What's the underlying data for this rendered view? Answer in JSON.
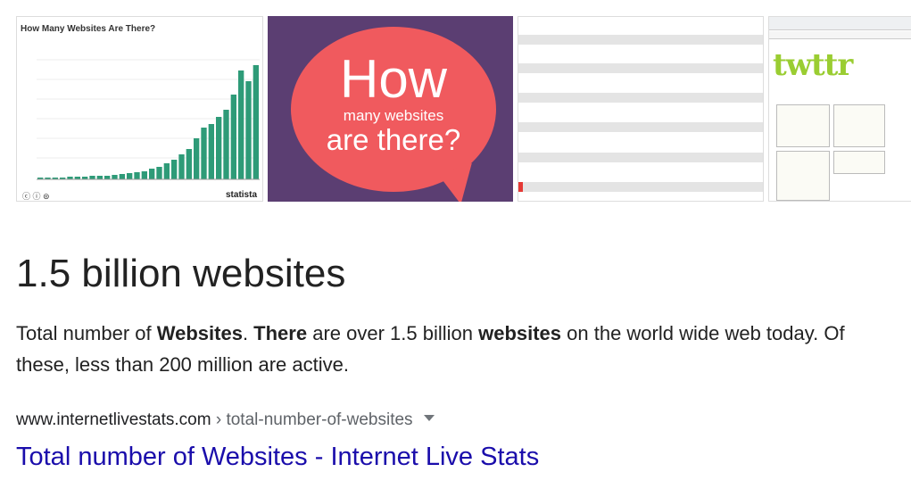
{
  "thumbnails": {
    "chart": {
      "title": "How Many Websites Are There?",
      "brand": "statista"
    },
    "bubble": {
      "line1": "How",
      "line2": "many websites",
      "line3": "are there?"
    },
    "twitter": {
      "logo": "twttr"
    }
  },
  "answer": {
    "headline": "1.5 billion websites",
    "snippet_parts": [
      {
        "text": "Total number of ",
        "bold": false
      },
      {
        "text": "Websites",
        "bold": true
      },
      {
        "text": ". ",
        "bold": false
      },
      {
        "text": "There",
        "bold": true
      },
      {
        "text": " are over 1.5 billion ",
        "bold": false
      },
      {
        "text": "websites",
        "bold": true
      },
      {
        "text": " on the world wide web today. Of these, less than 200 million are active.",
        "bold": false
      }
    ]
  },
  "result": {
    "domain": "www.internetlivestats.com",
    "path": " › total-number-of-websites",
    "title": "Total number of Websites - Internet Live Stats"
  },
  "colors": {
    "link": "#1a0dab",
    "bar": "#2e9b78",
    "bubble_bg": "#5b3e72",
    "bubble": "#f05a5e"
  }
}
